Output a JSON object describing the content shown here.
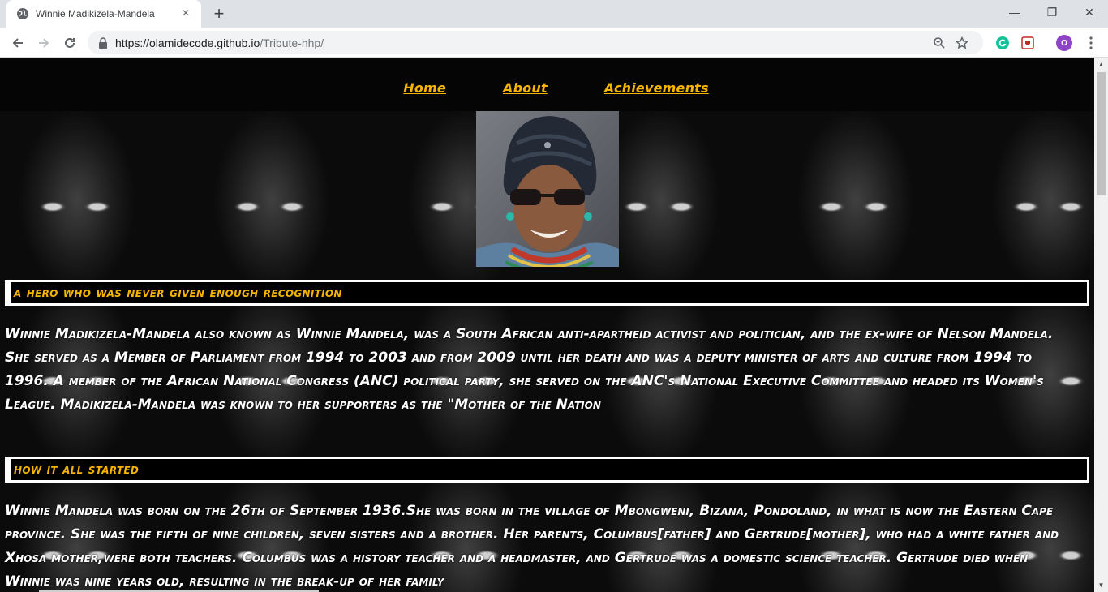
{
  "browser": {
    "tab_title": "Winnie Madikizela-Mandela",
    "url_host": "https://olamidecode.github.io",
    "url_path": "/Tribute-hhp/",
    "new_tab_glyph": "+",
    "close_glyph": "×",
    "minimize_glyph": "—",
    "restore_glyph": "❐",
    "window_close_glyph": "✕",
    "profile_initial": "O"
  },
  "site": {
    "nav": {
      "home": "Home",
      "about": "About",
      "achievements": "Achievements"
    },
    "sections": [
      {
        "heading": "A hero who was never given enough recognition",
        "text": "Winnie Madikizela-Mandela also known as Winnie Mandela, was a South African anti-apartheid activist and politician, and the ex-wife of Nelson Mandela. She served as a Member of Parliament from 1994 to 2003 and from 2009 until her death and was a deputy minister of arts and culture from 1994 to 1996. A member of the African National Congress (ANC) political party, she served on the ANC's National Executive Committee and headed its Women's League. Madikizela-Mandela was known to her supporters as the \"Mother of the Nation"
      },
      {
        "heading": "How it all started",
        "text": "Winnie Mandela was born on the 26th of September 1936.She was born in the village of Mbongweni, Bizana, Pondoland, in what is now the Eastern Cape province. She was the fifth of nine children, seven sisters and a brother. Her parents, Columbus[father] and Gertrude[mother], who had a white father and Xhosa mother,were both teachers. Columbus was a history teacher and a headmaster, and Gertrude was a domestic science teacher. Gertrude died when Winnie was nine years old, resulting in the break-up of her family"
      }
    ]
  },
  "colors": {
    "accent": "#f5b400",
    "text": "#ffffff",
    "background": "#000000"
  }
}
